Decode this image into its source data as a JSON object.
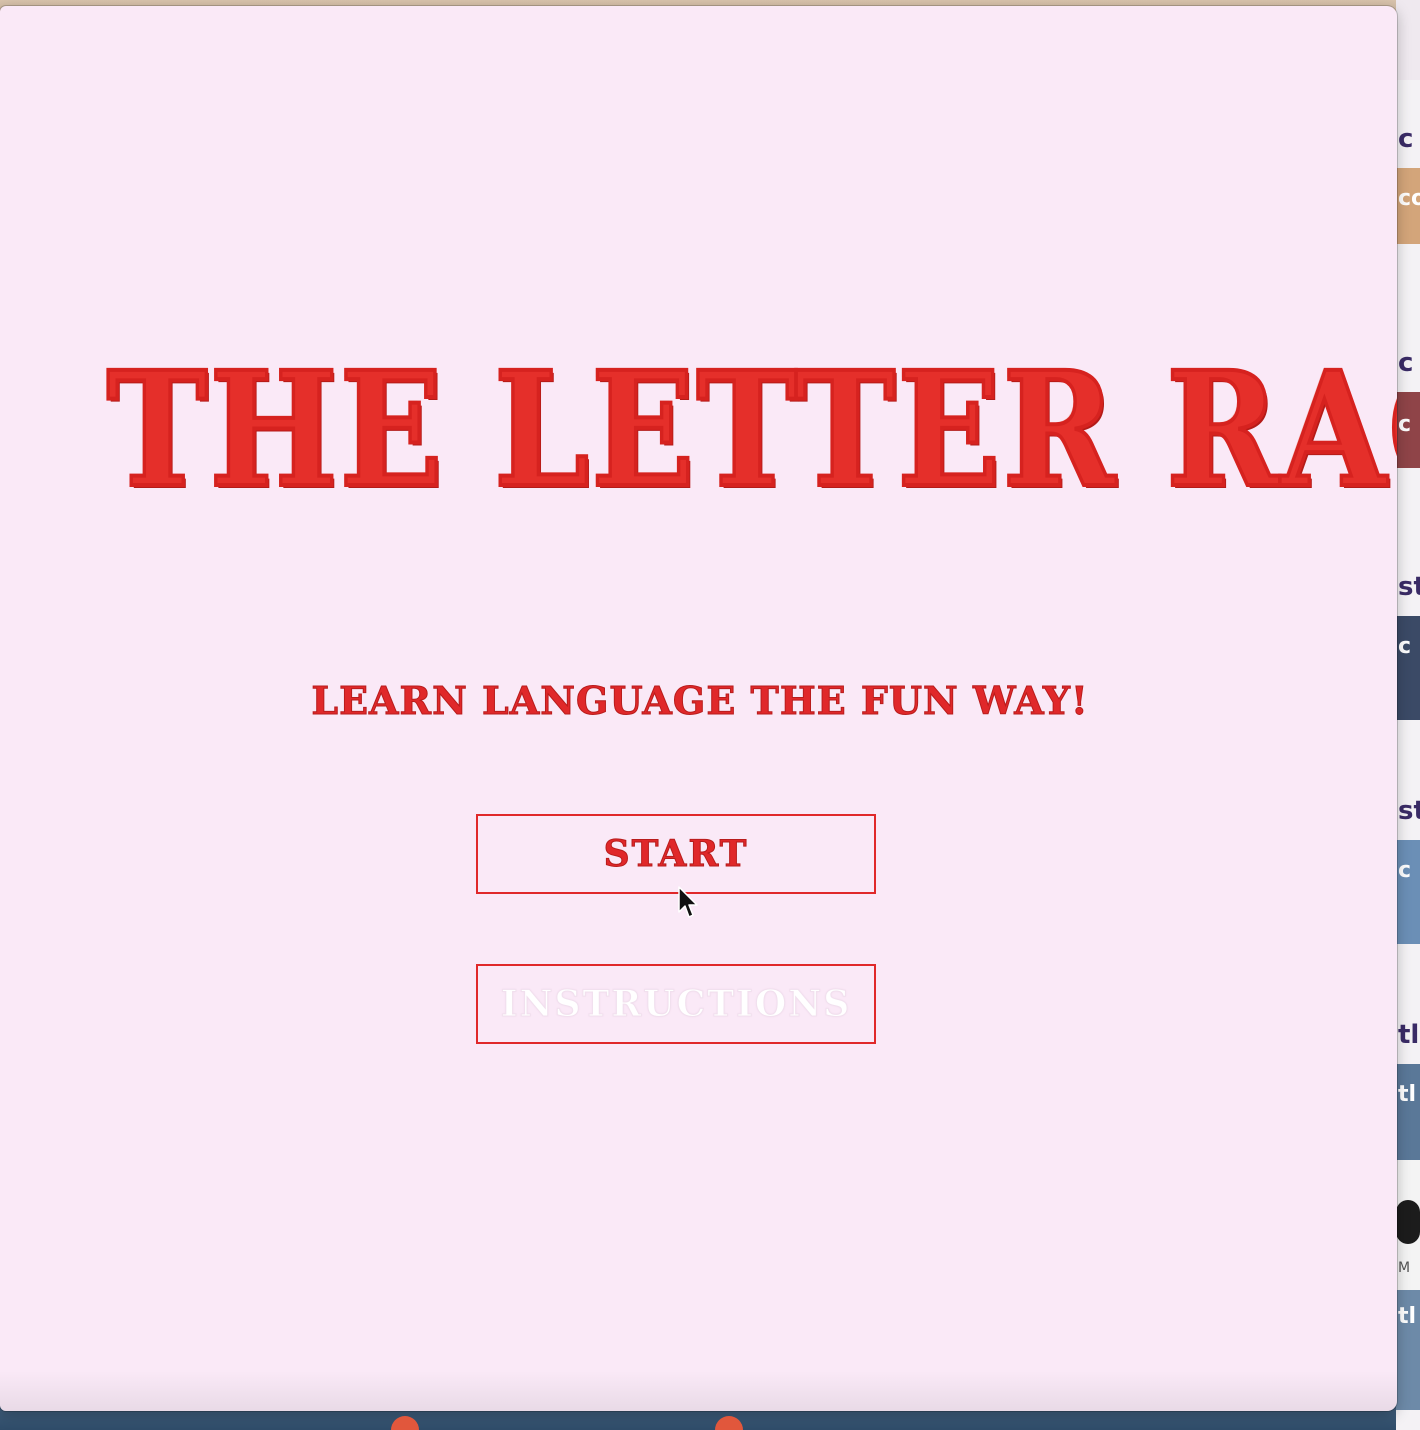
{
  "game": {
    "title": "THE LETTER RACE",
    "tagline": "LEARN LANGUAGE THE FUN WAY!",
    "buttons": {
      "start_label": "START",
      "instructions_label": "INSTRUCTIONS"
    }
  },
  "background_window": {
    "fragments": [
      "c",
      "co",
      "c",
      "c",
      "st",
      "c",
      "st",
      "c",
      "tl",
      "M",
      "tl"
    ]
  },
  "colors": {
    "accent_red": "#e52f2a",
    "window_background": "#fae9f7",
    "instructions_text": "#ffffff"
  }
}
